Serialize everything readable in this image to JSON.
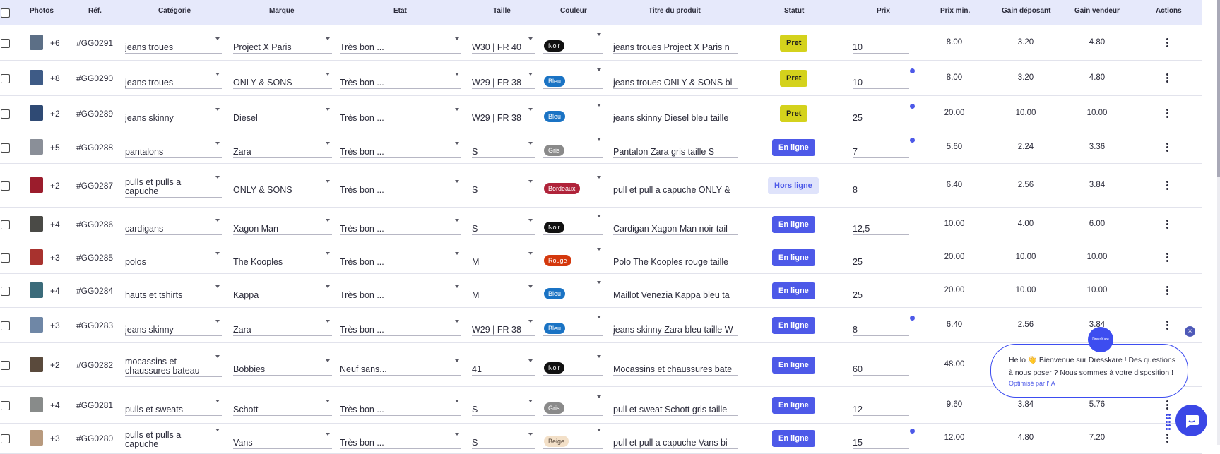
{
  "header": {
    "photos": "Photos",
    "ref": "Réf.",
    "categorie": "Catégorie",
    "marque": "Marque",
    "etat": "Etat",
    "taille": "Taille",
    "couleur": "Couleur",
    "titre": "Titre du produit",
    "statut": "Statut",
    "prix": "Prix",
    "prix_min": "Prix min.",
    "gain_deposant": "Gain déposant",
    "gain_vendeur": "Gain vendeur",
    "actions": "Actions"
  },
  "colors": {
    "Noir": "#111111",
    "Bleu": "#1a73c4",
    "Gris": "#8a8a8a",
    "Bordeaux": "#b0233a",
    "Rouge": "#d4380d",
    "Beige": "#f3e0c8",
    "pret": "#d4d21c",
    "en_ligne": "#4d59e8",
    "hors_ligne": "#dfe3fb"
  },
  "rows": [
    {
      "plus": "+6",
      "ref": "#GG0291",
      "categorie": "jeans troues",
      "marque": "Project X Paris",
      "etat": "Très bon ...",
      "taille": "W30 | FR 40",
      "couleur": "Noir",
      "titre": "jeans troues Project X Paris n",
      "statut": "Pret",
      "prix": "10",
      "prix_min": "8.00",
      "gain_deposant": "3.20",
      "gain_vendeur": "4.80",
      "dot": false,
      "thumb": "#5c6f86"
    },
    {
      "plus": "+8",
      "ref": "#GG0290",
      "categorie": "jeans troues",
      "marque": "ONLY & SONS",
      "etat": "Très bon ...",
      "taille": "W29 | FR 38",
      "couleur": "Bleu",
      "titre": "jeans troues ONLY & SONS bl",
      "statut": "Pret",
      "prix": "10",
      "prix_min": "8.00",
      "gain_deposant": "3.20",
      "gain_vendeur": "4.80",
      "dot": true,
      "thumb": "#3e5b86"
    },
    {
      "plus": "+2",
      "ref": "#GG0289",
      "categorie": "jeans skinny",
      "marque": "Diesel",
      "etat": "Très bon ...",
      "taille": "W29 | FR 38",
      "couleur": "Bleu",
      "titre": "jeans skinny Diesel bleu taille",
      "statut": "Pret",
      "prix": "25",
      "prix_min": "20.00",
      "gain_deposant": "10.00",
      "gain_vendeur": "10.00",
      "dot": true,
      "thumb": "#2f4a74"
    },
    {
      "plus": "+5",
      "ref": "#GG0288",
      "categorie": "pantalons",
      "marque": "Zara",
      "etat": "Très bon ...",
      "taille": "S",
      "couleur": "Gris",
      "titre": "Pantalon Zara gris taille S",
      "statut": "En ligne",
      "prix": "7",
      "prix_min": "5.60",
      "gain_deposant": "2.24",
      "gain_vendeur": "3.36",
      "dot": true,
      "thumb": "#8a8f98"
    },
    {
      "plus": "+2",
      "ref": "#GG0287",
      "categorie": "pulls et pulls a capuche",
      "marque": "ONLY & SONS",
      "etat": "Très bon ...",
      "taille": "S",
      "couleur": "Bordeaux",
      "titre": "pull et pull a capuche ONLY &",
      "statut": "Hors ligne",
      "prix": "8",
      "prix_min": "6.40",
      "gain_deposant": "2.56",
      "gain_vendeur": "3.84",
      "dot": false,
      "thumb": "#9b1c2c"
    },
    {
      "plus": "+4",
      "ref": "#GG0286",
      "categorie": "cardigans",
      "marque": "Xagon Man",
      "etat": "Très bon ...",
      "taille": "S",
      "couleur": "Noir",
      "titre": "Cardigan Xagon Man noir tail",
      "statut": "En ligne",
      "prix": "12,5",
      "prix_min": "10.00",
      "gain_deposant": "4.00",
      "gain_vendeur": "6.00",
      "dot": false,
      "thumb": "#4a4a46"
    },
    {
      "plus": "+3",
      "ref": "#GG0285",
      "categorie": "polos",
      "marque": "The Kooples",
      "etat": "Très bon ...",
      "taille": "M",
      "couleur": "Rouge",
      "titre": "Polo The Kooples rouge taille",
      "statut": "En ligne",
      "prix": "25",
      "prix_min": "20.00",
      "gain_deposant": "10.00",
      "gain_vendeur": "10.00",
      "dot": false,
      "thumb": "#a8322e"
    },
    {
      "plus": "+4",
      "ref": "#GG0284",
      "categorie": "hauts et tshirts",
      "marque": "Kappa",
      "etat": "Très bon ...",
      "taille": "M",
      "couleur": "Bleu",
      "titre": "Maillot Venezia Kappa bleu ta",
      "statut": "En ligne",
      "prix": "25",
      "prix_min": "20.00",
      "gain_deposant": "10.00",
      "gain_vendeur": "10.00",
      "dot": false,
      "thumb": "#3b6b7a"
    },
    {
      "plus": "+3",
      "ref": "#GG0283",
      "categorie": "jeans skinny",
      "marque": "Zara",
      "etat": "Très bon ...",
      "taille": "W29 | FR 38",
      "couleur": "Bleu",
      "titre": "jeans skinny Zara bleu taille W",
      "statut": "En ligne",
      "prix": "8",
      "prix_min": "6.40",
      "gain_deposant": "2.56",
      "gain_vendeur": "3.84",
      "dot": true,
      "thumb": "#6f87a6"
    },
    {
      "plus": "+2",
      "ref": "#GG0282",
      "categorie": "mocassins et chaussures bateau",
      "marque": "Bobbies",
      "etat": "Neuf sans...",
      "taille": "41",
      "couleur": "Noir",
      "titre": "Mocassins et chaussures bate",
      "statut": "En ligne",
      "prix": "60",
      "prix_min": "48.00",
      "gain_deposant": "",
      "gain_vendeur": "",
      "dot": false,
      "thumb": "#5a4a3c"
    },
    {
      "plus": "+4",
      "ref": "#GG0281",
      "categorie": "pulls et sweats",
      "marque": "Schott",
      "etat": "Très bon ...",
      "taille": "S",
      "couleur": "Gris",
      "titre": "pull et sweat Schott gris taille",
      "statut": "En ligne",
      "prix": "12",
      "prix_min": "9.60",
      "gain_deposant": "3.84",
      "gain_vendeur": "5.76",
      "dot": false,
      "thumb": "#888b8a"
    },
    {
      "plus": "+3",
      "ref": "#GG0280",
      "categorie": "pulls et pulls a capuche",
      "marque": "Vans",
      "etat": "Très bon ...",
      "taille": "S",
      "couleur": "Beige",
      "titre": "pull et pull a capuche Vans bi",
      "statut": "En ligne",
      "prix": "15",
      "prix_min": "12.00",
      "gain_deposant": "4.80",
      "gain_vendeur": "7.20",
      "dot": true,
      "thumb": "#b89a7e"
    }
  ],
  "popup": {
    "badge": "DressKare",
    "message": "Hello 👋 Bienvenue sur Dresskare ! Des questions à nous poser ? Nous sommes à votre disposition !",
    "sub": "Optimisé par l'IA",
    "close": "×"
  }
}
